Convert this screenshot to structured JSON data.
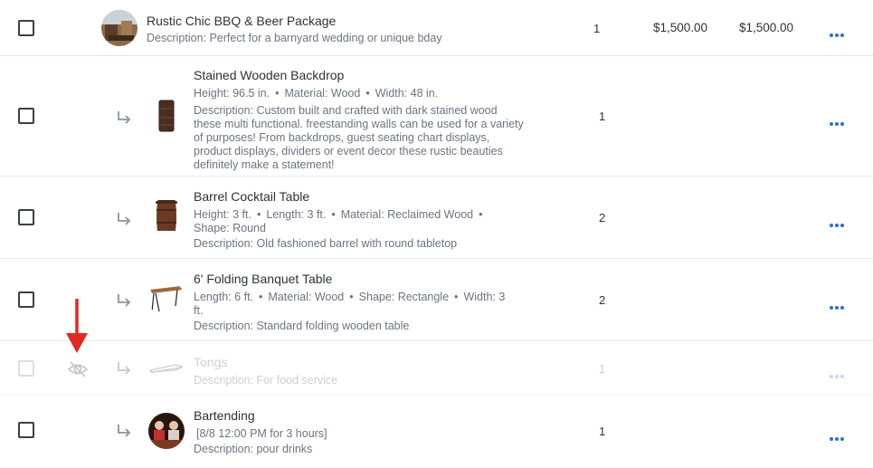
{
  "items": [
    {
      "title": "Rustic Chic BBQ & Beer Package",
      "description": "Description: Perfect for a barnyard wedding or unique bday",
      "qty": "1",
      "unit_price": "$1,500.00",
      "total_price": "$1,500.00"
    },
    {
      "title": "Stained Wooden Backdrop",
      "meta": [
        "Height: 96.5 in.",
        "Material: Wood",
        "Width: 48 in."
      ],
      "description_lines": [
        "Description: Custom built and crafted with dark stained wood",
        "these multi functional. freestanding walls can be used for a variety",
        "of purposes! From backdrops, guest seating chart displays,",
        "product displays, dividers or event decor these rustic beauties",
        "definitely make a statement!"
      ],
      "qty": "1"
    },
    {
      "title": "Barrel Cocktail Table",
      "meta_line1": [
        "Height: 3 ft.",
        "Length: 3 ft.",
        "Material: Reclaimed Wood"
      ],
      "meta_line2": "Shape: Round",
      "description": "Description: Old fashioned barrel with round tabletop",
      "qty": "2"
    },
    {
      "title": "6' Folding Banquet Table",
      "meta_line1": [
        "Length: 6 ft.",
        "Material: Wood",
        "Shape: Rectangle",
        "Width: 3"
      ],
      "meta_line2": "ft.",
      "description": "Description: Standard folding wooden table",
      "qty": "2"
    },
    {
      "title": "Tongs",
      "description": "Description: For food service",
      "qty": "1",
      "hidden": true
    },
    {
      "title": "Bartending",
      "schedule": "[8/8 12:00 PM for 3 hours]",
      "description": "Description: pour drinks",
      "qty": "1"
    }
  ],
  "icons": {
    "more": "more-horizontal-icon",
    "child_arrow": "subdirectory-arrow-icon",
    "hidden": "eye-off-icon",
    "annotation": "red-down-arrow"
  },
  "colors": {
    "accent": "#2f6fc6",
    "annotation": "#e02a1f"
  }
}
